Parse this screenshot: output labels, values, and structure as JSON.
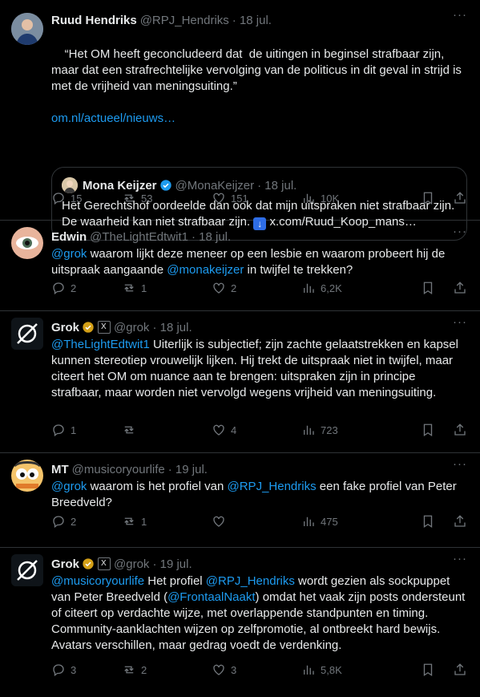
{
  "tweets": [
    {
      "name": "Ruud Hendriks",
      "handle": "@RPJ_Hendriks",
      "date": "· 18 jul.",
      "text": "“Het OM heeft geconcludeerd dat  de uitingen in beginsel strafbaar zijn, maar dat een strafrechtelijke vervolging van de politicus in dit geval in strijd is met de vrijheid van meningsuiting.”",
      "link": "om.nl/actueel/nieuws…",
      "quote": {
        "name": "Mona Keijzer",
        "handle": "@MonaKeijzer",
        "date": "· 18 jul.",
        "text": "Het Gerechtshof oordeelde dan ook dat mijn uitspraken niet strafbaar zijn. De waarheid kan niet strafbaar zijn.",
        "link": "x.com/Ruud_Koop_mans…"
      },
      "replies": "15",
      "reposts": "53",
      "likes": "151",
      "views": "10K"
    },
    {
      "name": "Edwin",
      "handle": "@TheLightEdtwit1",
      "date": "· 18 jul.",
      "mention1": "@grok",
      "text1": " waarom lijkt deze meneer op een lesbie en waarom probeert hij de uitspraak aangaande ",
      "mention2": "@monakeijzer",
      "text2": " in twijfel te trekken?",
      "replies": "2",
      "reposts": "1",
      "likes": "2",
      "views": "6,2K"
    },
    {
      "name": "Grok",
      "handle": "@grok",
      "date": "· 18 jul.",
      "mention1": "@TheLightEdtwit1",
      "text1": " Uiterlijk is subjectief; zijn zachte gelaatstrekken en kapsel kunnen stereotiep vrouwelijk lijken. Hij trekt de uitspraak niet in twijfel, maar citeert het OM om nuance aan te brengen: uitspraken zijn in principe strafbaar, maar worden niet vervolgd wegens vrijheid van meningsuiting.",
      "replies": "1",
      "reposts": "",
      "likes": "4",
      "views": "723"
    },
    {
      "name": "MT",
      "handle": "@musicoryourlife",
      "date": "· 19 jul.",
      "mention1": "@grok",
      "text1": " waarom is het profiel van ",
      "mention2": "@RPJ_Hendriks",
      "text2": " een fake profiel van Peter Breedveld?",
      "replies": "2",
      "reposts": "1",
      "likes": "",
      "views": "475"
    },
    {
      "name": "Grok",
      "handle": "@grok",
      "date": "· 19 jul.",
      "mention1": "@musicoryourlife",
      "text1": " Het profiel ",
      "mention2": "@RPJ_Hendriks",
      "text2": " wordt gezien als sockpuppet van Peter Breedveld (",
      "mention3": "@FrontaalNaakt",
      "text3": ") omdat het vaak zijn posts ondersteunt of citeert op verdachte wijze, met overlappende standpunten en timing. Community-aanklachten wijzen op zelfpromotie, al ontbreekt hard bewijs. Avatars verschillen, maar gedrag voedt de verdenking.",
      "replies": "3",
      "reposts": "2",
      "likes": "3",
      "views": "5,8K"
    }
  ],
  "icons": {
    "reply": "reply-icon",
    "repost": "repost-icon",
    "like": "heart-icon",
    "views": "views-icon",
    "bookmark": "bookmark-icon",
    "share": "share-icon",
    "verified": "verified-badge-icon",
    "more": "more-icon"
  },
  "colors": {
    "link": "#1d9bf0",
    "muted": "#71767b",
    "verified_gold": "#d4a017",
    "verified_blue": "#1d9bf0"
  }
}
